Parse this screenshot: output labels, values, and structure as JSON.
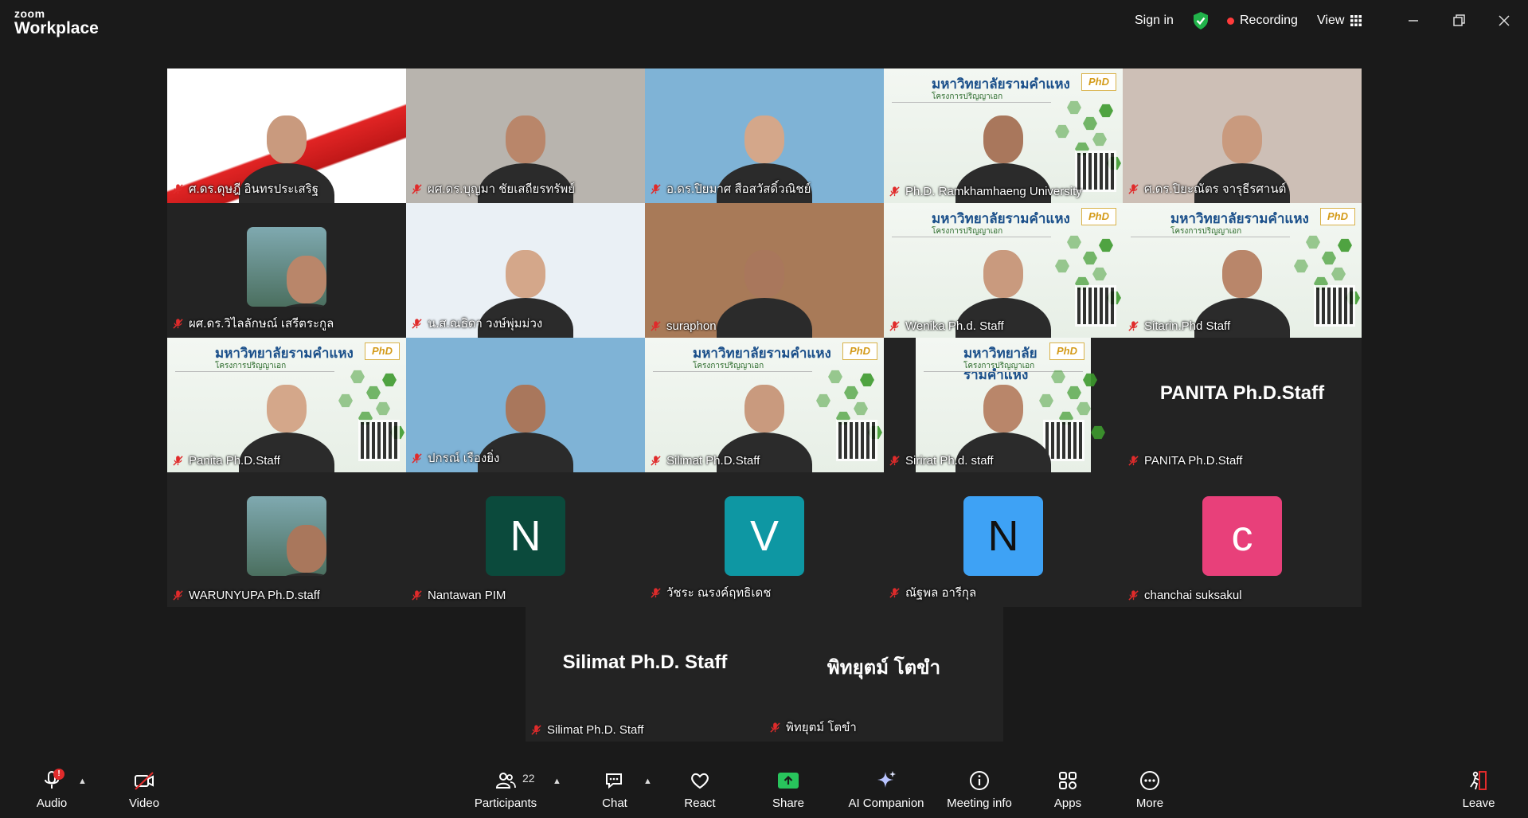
{
  "app": {
    "logo_top": "zoom",
    "logo_bottom": "Workplace"
  },
  "titlebar": {
    "sign_in": "Sign in",
    "recording": "Recording",
    "view": "View",
    "icons": [
      "shield-check-icon",
      "grid-icon",
      "minimize-icon",
      "restore-icon",
      "close-icon"
    ]
  },
  "poster": {
    "title": "มหาวิทยาลัยรามคำแหง",
    "subtitle": "โครงการปริญญาเอก",
    "badge": "PhD"
  },
  "participants": [
    {
      "name": "ศ.ดร.ดุษฎี อินทรประเสริฐ",
      "kind": "video",
      "active": true
    },
    {
      "name": "ผศ.ดร.บุญมา ชัยเสถียรทรัพย์",
      "kind": "video"
    },
    {
      "name": "อ.ดร.ปิยมาศ สือสวัสดิ์วณิชย์",
      "kind": "video"
    },
    {
      "name": "Ph.D. Ramkhamhaeng University",
      "kind": "poster"
    },
    {
      "name": "ศ.ดร.ปิยะณัตร จารุธีรศานต์",
      "kind": "video"
    },
    {
      "name": "ผศ.ดร.วิไลลักษณ์ เสรีตระกูล",
      "kind": "photo"
    },
    {
      "name": "น.ส.ณธิดา วงษ์พุ่มม่วง",
      "kind": "video"
    },
    {
      "name": "suraphon",
      "kind": "video"
    },
    {
      "name": "Wenika Ph.d. Staff",
      "kind": "poster"
    },
    {
      "name": "Sitarin.Phd Staff",
      "kind": "poster"
    },
    {
      "name": "Panita Ph.D.Staff",
      "kind": "poster"
    },
    {
      "name": "ปกรณ์ เรืองยิ่ง",
      "kind": "video"
    },
    {
      "name": "Silimat Ph.D.Staff",
      "kind": "poster"
    },
    {
      "name": "Sirirat Ph.d. staff",
      "kind": "poster-narrow"
    },
    {
      "name": "PANITA Ph.D.Staff",
      "kind": "name",
      "display": "PANITA Ph.D.Staff"
    },
    {
      "name": "WARUNYUPA Ph.D.staff",
      "kind": "photo"
    },
    {
      "name": "Nantawan PIM",
      "kind": "letter",
      "letter": "N",
      "color": "#0b4a3c"
    },
    {
      "name": "วัชระ ณรงค์ฤทธิเดช",
      "kind": "letter",
      "letter": "V",
      "color": "#0e97a3"
    },
    {
      "name": "ณัฐพล อารีกุล",
      "kind": "letter",
      "letter": "N",
      "color": "#3ea2f5",
      "dark": true
    },
    {
      "name": "chanchai suksakul",
      "kind": "letter",
      "letter": "c",
      "color": "#e8407a"
    },
    {
      "name": "Silimat Ph.D. Staff",
      "kind": "name",
      "display": "Silimat Ph.D. Staff"
    },
    {
      "name": "พิทยุตม์ โตขำ",
      "kind": "name",
      "display": "พิทยุตม์ โตขำ"
    }
  ],
  "toolbar": {
    "audio": "Audio",
    "audio_badge": "!",
    "video": "Video",
    "participants": "Participants",
    "participants_count": "22",
    "chat": "Chat",
    "react": "React",
    "share": "Share",
    "ai_companion": "AI Companion",
    "meeting_info": "Meeting info",
    "apps": "Apps",
    "more": "More",
    "leave": "Leave",
    "colors": {
      "share_green": "#28c45c",
      "leave_red": "#e02b2b",
      "active_border": "#2ecc71",
      "recording_dot": "#ff3b3b"
    }
  }
}
